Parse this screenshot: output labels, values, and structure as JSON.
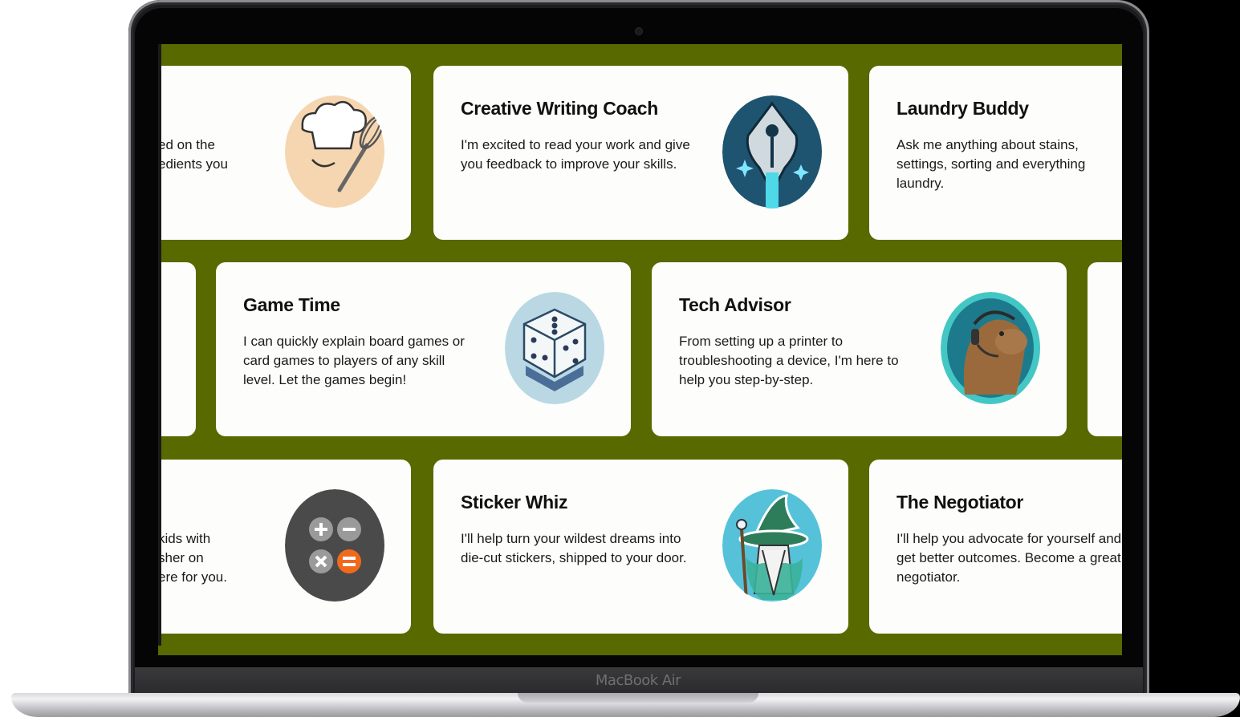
{
  "device": {
    "brand": "MacBook Air"
  },
  "cards": {
    "chef_partial": {
      "desc_lines": [
        "ed on the",
        "edients you"
      ]
    },
    "writing_coach": {
      "title": "Creative Writing Coach",
      "desc": "I'm excited to read your work and give you feedback to improve your skills."
    },
    "laundry": {
      "title": "Laundry Buddy",
      "desc": "Ask me anything about stains, settings, sorting and everything laundry."
    },
    "game_time": {
      "title": "Game Time",
      "desc": "I can quickly explain board games or card games to players of any skill level. Let the games begin!"
    },
    "tech_advisor": {
      "title": "Tech Advisor",
      "desc": "From setting up a printer to troubleshooting a device, I'm here to help you step-by-step."
    },
    "math_partial": {
      "desc_lines": [
        "kids with",
        "sher on",
        "ere for you."
      ]
    },
    "sticker_whiz": {
      "title": "Sticker Whiz",
      "desc": "I'll help turn your wildest dreams into die-cut stickers, shipped to your door."
    },
    "negotiator": {
      "title": "The Negotiator",
      "desc": "I'll help you advocate for yourself and get better outcomes. Become a great negotiator."
    }
  },
  "icons": {
    "chef": "chef-whisk-icon",
    "writing": "fountain-pen-icon",
    "dice": "dice-icon",
    "tech": "capybara-headset-icon",
    "calculator": "calculator-icon",
    "wizard": "wizard-icon"
  },
  "colors": {
    "screen_background": "#586900",
    "card_background": "#fdfdfb"
  }
}
